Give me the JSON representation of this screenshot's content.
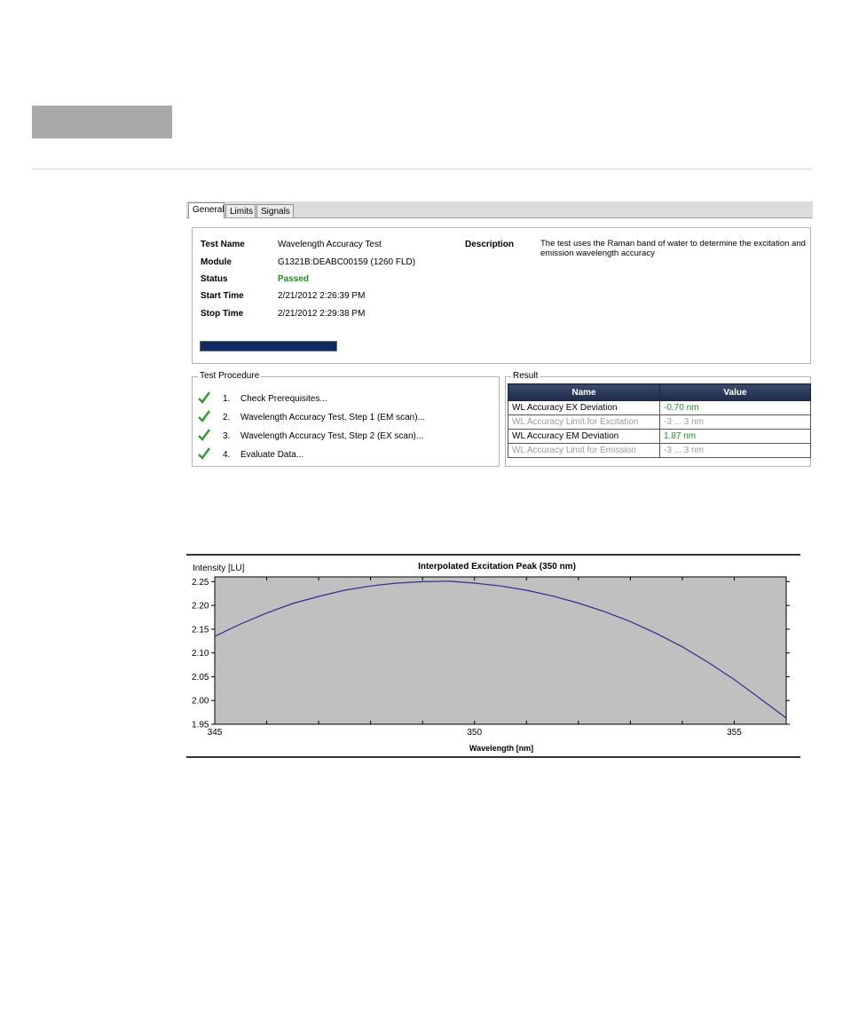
{
  "tabs": [
    {
      "label": "General",
      "active": true
    },
    {
      "label": "Limits",
      "active": false
    },
    {
      "label": "Signals",
      "active": false
    }
  ],
  "info": {
    "test_name_label": "Test Name",
    "test_name_value": "Wavelength Accuracy Test",
    "module_label": "Module",
    "module_value": "G1321B:DEABC00159 (1260 FLD)",
    "status_label": "Status",
    "status_value": "Passed",
    "start_label": "Start Time",
    "start_value": "2/21/2012 2:26:39 PM",
    "stop_label": "Stop Time",
    "stop_value": "2/21/2012 2:29:38 PM",
    "description_label": "Description",
    "description_value": "The test uses the Raman band of water to determine the excitation and emission wavelength accuracy",
    "progress": 1.0
  },
  "procedure": {
    "title": "Test Procedure",
    "steps": [
      {
        "num": "1.",
        "text": "Check Prerequisites..."
      },
      {
        "num": "2.",
        "text": "Wavelength Accuracy Test, Step 1 (EM scan)..."
      },
      {
        "num": "3.",
        "text": "Wavelength Accuracy Test, Step 2 (EX scan)..."
      },
      {
        "num": "4.",
        "text": "Evaluate Data..."
      }
    ]
  },
  "result": {
    "title": "Result",
    "col_name": "Name",
    "col_value": "Value",
    "rows": [
      {
        "name": "WL Accuracy EX Deviation",
        "value": "-0.70 nm",
        "sub": false
      },
      {
        "name": "WL Accuracy Limit for Excitation",
        "value": "-3 ... 3 nm",
        "sub": true
      },
      {
        "name": "WL Accuracy EM Deviation",
        "value": "1.87 nm",
        "sub": false
      },
      {
        "name": "WL Accuracy Limit for Emission",
        "value": "-3 ... 3 nm",
        "sub": true
      }
    ]
  },
  "colors": {
    "check": "#2e9d2e",
    "plot_bg": "#c0c0c0",
    "curve": "#2b2f8f"
  },
  "chart_data": {
    "type": "line",
    "title": "Interpolated Excitation Peak (350 nm)",
    "ylabel": "Intensity [LU]",
    "xlabel": "Wavelength [nm]",
    "xlim": [
      345,
      356
    ],
    "ylim": [
      1.95,
      2.26
    ],
    "x_ticks": [
      345,
      350,
      355
    ],
    "y_ticks": [
      "1.95",
      "2.00",
      "2.05",
      "2.10",
      "2.15",
      "2.20",
      "2.25"
    ],
    "series": [
      {
        "x": [
          345,
          345.5,
          346,
          346.5,
          347,
          347.5,
          348,
          348.5,
          349,
          349.5,
          350,
          350.5,
          351,
          351.5,
          352,
          352.5,
          353,
          353.5,
          354,
          354.5,
          355,
          355.5,
          356
        ],
        "y": [
          2.135,
          2.161,
          2.184,
          2.204,
          2.219,
          2.232,
          2.241,
          2.247,
          2.25,
          2.251,
          2.247,
          2.241,
          2.232,
          2.22,
          2.205,
          2.187,
          2.166,
          2.141,
          2.113,
          2.08,
          2.044,
          2.004,
          1.963
        ]
      }
    ],
    "grid": false
  }
}
